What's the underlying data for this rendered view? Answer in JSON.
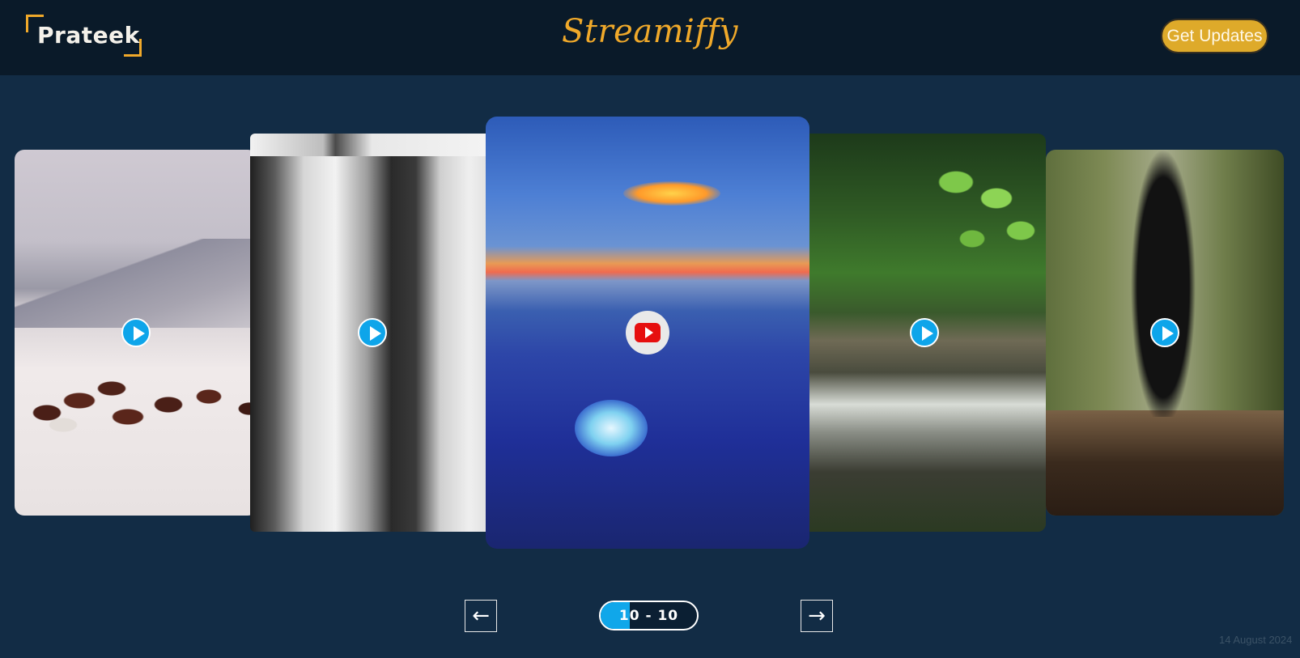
{
  "header": {
    "logo_text": "Prateek",
    "brand": "Streamiffy",
    "updates_button": "Get Updates"
  },
  "carousel": {
    "cards": [
      {
        "scene": "wild horses running across a snowy plain",
        "icon": "play-icon"
      },
      {
        "scene": "frozen waterfall over dark rocks",
        "icon": "play-icon"
      },
      {
        "scene": "glowing sea glass pebbles on a beach at sunset",
        "icon": "youtube-play-icon"
      },
      {
        "scene": "forest stream with small waterfall and green leaves",
        "icon": "play-icon"
      },
      {
        "scene": "blurred person walking on a forest trail",
        "icon": "play-icon"
      }
    ]
  },
  "pagination": {
    "label": "10 - 10",
    "progress": 0.3,
    "prev_icon": "arrow-left-icon",
    "next_icon": "arrow-right-icon"
  },
  "footer": {
    "date": "14 August 2024"
  },
  "colors": {
    "accent": "#f0a92a",
    "button_bg": "#deaa2a",
    "page_bg": "#122c45",
    "header_bg": "#0a1a29",
    "progress_fill": "#10a7ea"
  }
}
